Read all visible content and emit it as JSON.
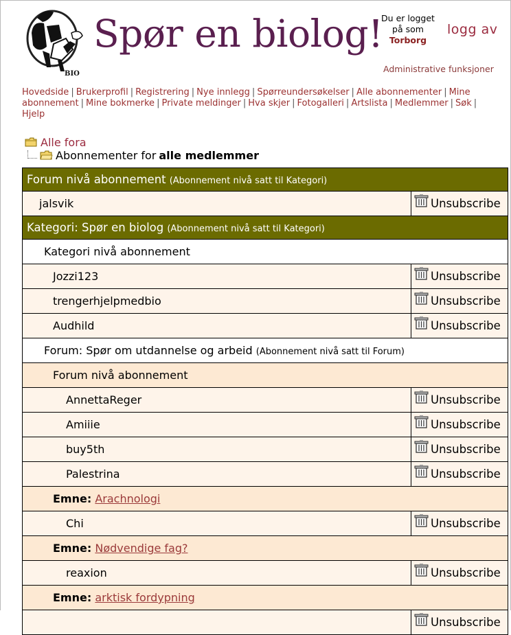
{
  "header": {
    "site_title": "Spør en biolog!",
    "logo_text": "BIO",
    "login_line1": "Du er logget",
    "login_line2": "på som",
    "username": "Torborg",
    "logout_label": "logg av",
    "admin_label": "Administrative funksjoner"
  },
  "nav": {
    "items": [
      "Hovedside",
      "Brukerprofil",
      "Registrering",
      "Nye innlegg",
      "Spørreundersøkelser",
      "Alle abonnementer",
      "Mine abonnement",
      "Mine bokmerke",
      "Private meldinger",
      "Hva skjer",
      "Fotogalleri",
      "Artslista",
      "Medlemmer",
      "Søk",
      "Hjelp"
    ]
  },
  "breadcrumb": {
    "root": "Alle fora",
    "current_prefix": "Abonnementer for",
    "current_bold": "alle medlemmer"
  },
  "table": {
    "forum_header": "Forum nivå abonnement",
    "forum_header_note": "(Abonnement nivå satt til Kategori)",
    "forum_rows": [
      "jalsvik"
    ],
    "category_header": "Kategori: Spør en biolog",
    "category_header_note": "(Abonnement nivå satt til Kategori)",
    "category_level_label": "Kategori nivå abonnement",
    "category_rows": [
      "Jozzi123",
      "trengerhjelpmedbio",
      "Audhild"
    ],
    "forum_title": "Forum: Spør om utdannelse og arbeid",
    "forum_title_note": "(Abonnement nivå satt til Forum)",
    "forum_level_label": "Forum nivå abonnement",
    "forum_level_rows": [
      "AnnettaReger",
      "Amiiie",
      "buy5th",
      "Palestrina"
    ],
    "topic_label": "Emne:",
    "topics": [
      {
        "title": "Arachnologi",
        "users": [
          "Chi"
        ]
      },
      {
        "title": "Nødvendige fag?",
        "users": [
          "reaxion"
        ]
      },
      {
        "title": "arktisk fordypning",
        "users": []
      }
    ],
    "unsubscribe_label": "Unsubscribe"
  },
  "colors": {
    "header_bg": "#6b6b00",
    "title_purple": "#5a1f4f",
    "link_red": "#9b3232",
    "row_light": "#fef4ea",
    "row_tan": "#fde9d3"
  }
}
